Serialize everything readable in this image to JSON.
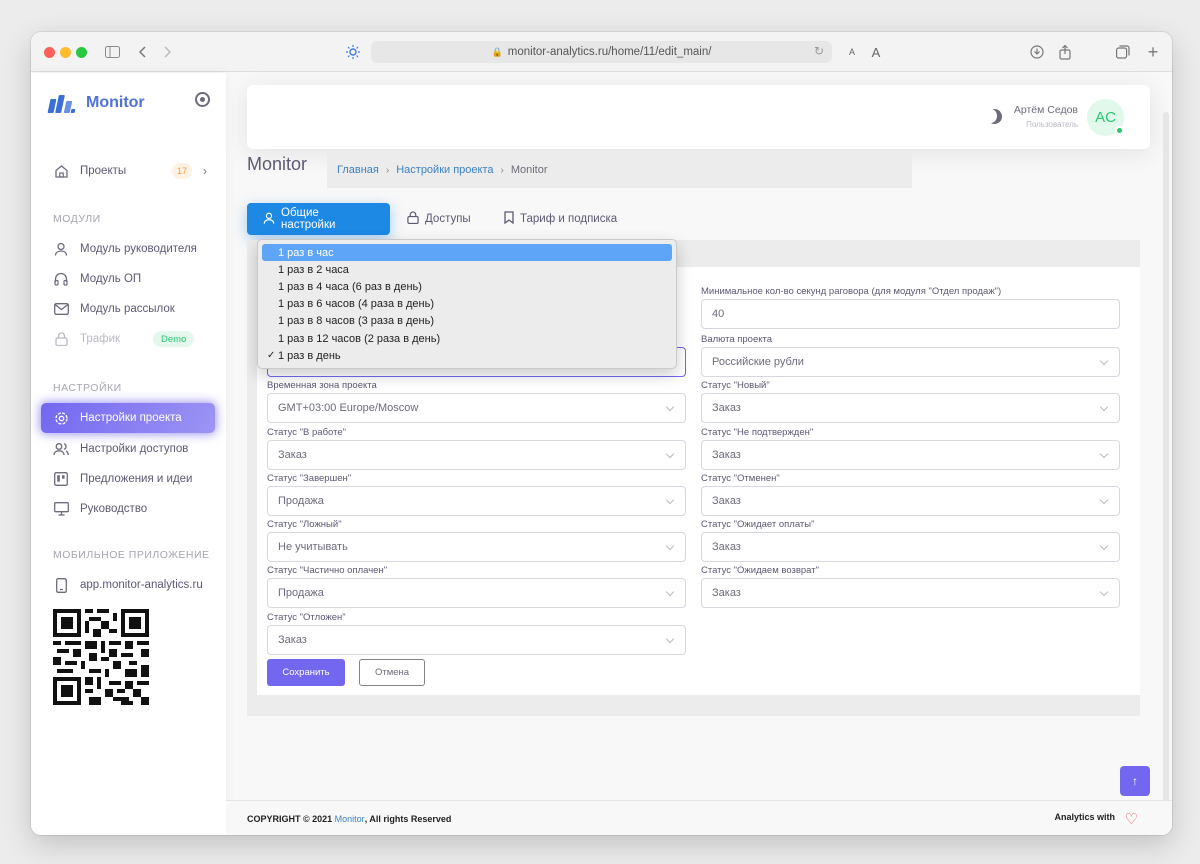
{
  "browser": {
    "url": "monitor-analytics.ru/home/11/edit_main/"
  },
  "sidebar": {
    "brand": "Monitor",
    "projects": {
      "label": "Проекты",
      "count": "17"
    },
    "sections": {
      "modules": "МОДУЛИ",
      "settings": "НАСТРОЙКИ",
      "mobile": "МОБИЛЬНОЕ ПРИЛОЖЕНИЕ"
    },
    "items": [
      {
        "label": "Модуль руководителя",
        "icon": "user-icon"
      },
      {
        "label": "Модуль ОП",
        "icon": "headphones-icon"
      },
      {
        "label": "Модуль рассылок",
        "icon": "mail-icon"
      },
      {
        "label": "Трафик",
        "icon": "lock-icon",
        "badge": "Demo"
      },
      {
        "label": "Настройки проекта",
        "icon": "gear-icon"
      },
      {
        "label": "Настройки доступов",
        "icon": "users-icon"
      },
      {
        "label": "Предложения и идеи",
        "icon": "board-icon"
      },
      {
        "label": "Руководство",
        "icon": "monitor-icon"
      },
      {
        "label": "app.monitor-analytics.ru",
        "icon": "phone-icon"
      }
    ]
  },
  "header": {
    "user_name": "Артём Седов",
    "user_role": "Пользователь",
    "avatar_initials": "AC"
  },
  "page": {
    "title": "Monitor",
    "breadcrumb": [
      "Главная",
      "Настройки проекта",
      "Monitor"
    ]
  },
  "tabs": [
    {
      "label": "Общие настройки",
      "icon": "user-icon",
      "active": true
    },
    {
      "label": "Доступы",
      "icon": "lock-icon",
      "active": false
    },
    {
      "label": "Тариф и подписка",
      "icon": "bookmark-icon",
      "active": false
    }
  ],
  "form": {
    "min_seconds": {
      "label": "Минимальное кол-во секунд раговора (для модуля \"Отдел продаж\")",
      "value": "40"
    },
    "currency": {
      "label": "Валюта проекта",
      "value": "Российские рубли"
    },
    "timezone": {
      "label": "Временная зона проекта",
      "value": "GMT+03:00 Europe/Moscow"
    },
    "status_new": {
      "label": "Статус \"Новый\"",
      "value": "Заказ"
    },
    "status_in_work": {
      "label": "Статус \"В работе\"",
      "value": "Заказ"
    },
    "status_not_confirmed": {
      "label": "Статус \"Не подтвержден\"",
      "value": "Заказ"
    },
    "status_completed": {
      "label": "Статус \"Завершен\"",
      "value": "Продажа"
    },
    "status_cancelled": {
      "label": "Статус \"Отменен\"",
      "value": "Заказ"
    },
    "status_false": {
      "label": "Статус \"Ложный\"",
      "value": "Не учитывать"
    },
    "status_awaiting_payment": {
      "label": "Статус \"Ожидает оплаты\"",
      "value": "Заказ"
    },
    "status_partially_paid": {
      "label": "Статус \"Частично оплачен\"",
      "value": "Продажа"
    },
    "status_awaiting_return": {
      "label": "Статус \"Ожидаем возврат\"",
      "value": "Заказ"
    },
    "status_postponed": {
      "label": "Статус \"Отложен\"",
      "value": "Заказ"
    },
    "save_label": "Сохранить",
    "cancel_label": "Отмена"
  },
  "dropdown": {
    "options": [
      "1 раз в час",
      "1 раз в 2 часа",
      "1 раз в 4 часа (6 раз в день)",
      "1 раз в 6 часов (4 раза в день)",
      "1 раз в 8 часов (3 раза в день)",
      "1 раз в 12 часов (2 раза в день)",
      "1 раз в день"
    ],
    "highlighted": "1 раз в час",
    "selected": "1 раз в день"
  },
  "footer": {
    "copyright_prefix": "COPYRIGHT © 2021 ",
    "copyright_link": "Monitor",
    "copyright_suffix": ", All rights Reserved",
    "analytics": "Analytics with"
  },
  "colors": {
    "accent": "#7367f0",
    "tab_active": "#1e88e5",
    "link": "#3b82c4"
  }
}
